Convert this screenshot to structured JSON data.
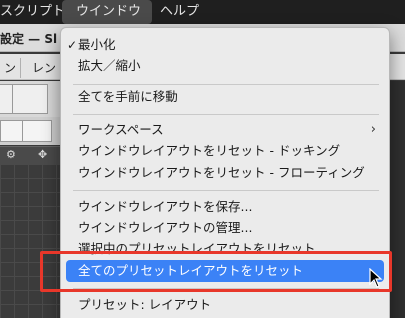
{
  "menubar": {
    "items": [
      "スクリプト",
      "ウインドウ",
      "ヘルプ"
    ]
  },
  "app": {
    "title": "設定 — Sl",
    "tabs": [
      "ン",
      "レン"
    ]
  },
  "menu": {
    "items": [
      {
        "label": "最小化",
        "checked": true
      },
      {
        "label": "拡大／縮小"
      },
      {
        "label": "全てを手前に移動"
      },
      {
        "label": "ワークスペース",
        "submenu": true
      },
      {
        "label": "ウインドウレイアウトをリセット - ドッキング"
      },
      {
        "label": "ウインドウレイアウトをリセット - フローティング"
      },
      {
        "label": "ウインドウレイアウトを保存..."
      },
      {
        "label": "ウインドウレイアウトの管理..."
      },
      {
        "label": "選択中のプリセットレイアウトをリセット"
      },
      {
        "label": "全てのプリセットレイアウトをリセット",
        "highlighted": true
      },
      {
        "label": "プリセット: レイアウト"
      }
    ],
    "highlight_color": "#3b82f6",
    "annotation_color": "#e8372a"
  }
}
